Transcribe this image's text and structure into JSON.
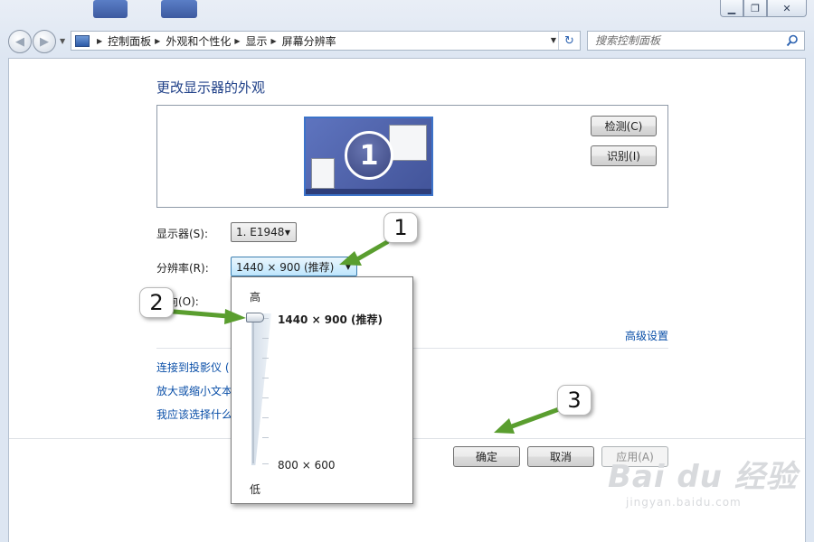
{
  "window": {
    "controls": {
      "minimize": "▁",
      "maximize": "❐",
      "close": "✕"
    }
  },
  "nav": {
    "back": "◀",
    "forward": "▶",
    "breadcrumb": [
      "控制面板",
      "外观和个性化",
      "显示",
      "屏幕分辨率"
    ],
    "refresh": "↻",
    "search_placeholder": "搜索控制面板"
  },
  "page": {
    "title": "更改显示器的外观",
    "detect_button": "检测(C)",
    "identify_button": "识别(I)",
    "monitor_number": "1",
    "display_label": "显示器(S):",
    "display_value": "1. E1948",
    "resolution_label": "分辨率(R):",
    "resolution_value": "1440 × 900 (推荐)",
    "orientation_label": "方向(O):",
    "advanced_link": "高级设置",
    "links": [
      "连接到投影仪 (",
      "放大或缩小文本",
      "我应该选择什么"
    ],
    "ok_button": "确定",
    "cancel_button": "取消",
    "apply_button": "应用(A)"
  },
  "resolution_panel": {
    "high_label": "高",
    "low_label": "低",
    "max_resolution": "1440 × 900 (推荐)",
    "min_resolution": "800 × 600",
    "slider_value": 1.0
  },
  "annotations": {
    "step1": "1",
    "step2": "2",
    "step3": "3",
    "arrow_color": "#5a9e2f"
  },
  "watermark": {
    "brand": "Bai du 经验",
    "url": "jingyan.baidu.com"
  },
  "colors": {
    "title": "#1e3f87",
    "link": "#0a4fa8",
    "accent": "#3c73c9"
  }
}
